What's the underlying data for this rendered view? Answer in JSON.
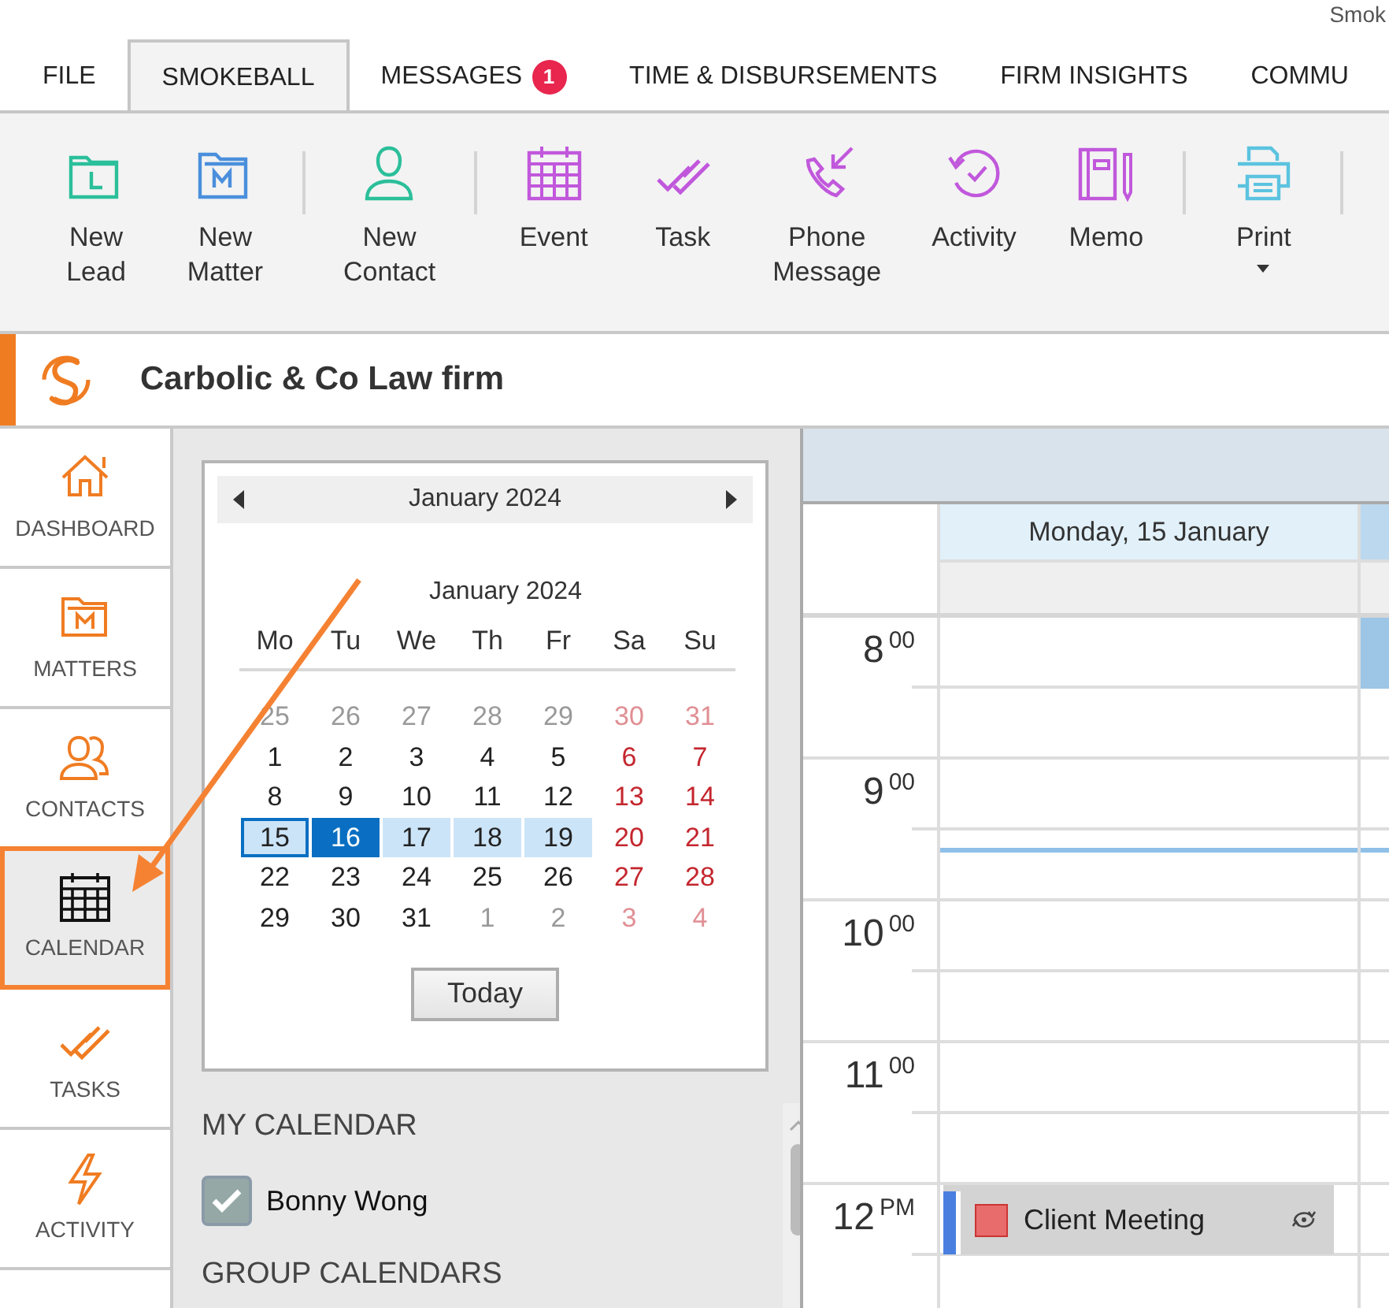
{
  "title_bar": {
    "title": "Smok"
  },
  "tabs": [
    {
      "label": "FILE",
      "selected": false
    },
    {
      "label": "SMOKEBALL",
      "selected": true
    },
    {
      "label": "MESSAGES",
      "selected": false,
      "badge": "1"
    },
    {
      "label": "TIME & DISBURSEMENTS",
      "selected": false
    },
    {
      "label": "FIRM INSIGHTS",
      "selected": false
    },
    {
      "label": "COMMU",
      "selected": false
    }
  ],
  "ribbon": [
    {
      "label": "New Lead",
      "color": "#2bbf9a",
      "separator_after": false
    },
    {
      "label": "New Matter",
      "color": "#4a8fdc",
      "separator_after": true
    },
    {
      "label": "New Contact",
      "color": "#2bbf9a",
      "separator_after": true
    },
    {
      "label": "Event",
      "color": "#c158dc",
      "separator_after": false
    },
    {
      "label": "Task",
      "color": "#c158dc",
      "separator_after": false
    },
    {
      "label": "Phone Message",
      "color": "#c158dc",
      "separator_after": false
    },
    {
      "label": "Activity",
      "color": "#c158dc",
      "separator_after": false
    },
    {
      "label": "Memo",
      "color": "#c158dc",
      "separator_after": true
    },
    {
      "label": "Print",
      "color": "#5bc3e0",
      "separator_after": true,
      "dropdown": true
    }
  ],
  "firm": {
    "name": "Carbolic & Co Law firm"
  },
  "nav": [
    {
      "label": "DASHBOARD",
      "selected": false
    },
    {
      "label": "MATTERS",
      "selected": false
    },
    {
      "label": "CONTACTS",
      "selected": false
    },
    {
      "label": "CALENDAR",
      "selected": true
    },
    {
      "label": "TASKS",
      "selected": false
    },
    {
      "label": "ACTIVITY",
      "selected": false
    }
  ],
  "mini_calendar": {
    "header": "January 2024",
    "month_title": "January 2024",
    "weekdays": [
      "Mo",
      "Tu",
      "We",
      "Th",
      "Fr",
      "Sa",
      "Su"
    ],
    "weeks": [
      [
        {
          "day": "25",
          "outside": true,
          "weekend": false,
          "today": false,
          "selected": false,
          "in_week": false
        },
        {
          "day": "26",
          "outside": true,
          "weekend": false,
          "today": false,
          "selected": false,
          "in_week": false
        },
        {
          "day": "27",
          "outside": true,
          "weekend": false,
          "today": false,
          "selected": false,
          "in_week": false
        },
        {
          "day": "28",
          "outside": true,
          "weekend": false,
          "today": false,
          "selected": false,
          "in_week": false
        },
        {
          "day": "29",
          "outside": true,
          "weekend": false,
          "today": false,
          "selected": false,
          "in_week": false
        },
        {
          "day": "30",
          "outside": true,
          "weekend": true,
          "today": false,
          "selected": false,
          "in_week": false
        },
        {
          "day": "31",
          "outside": true,
          "weekend": true,
          "today": false,
          "selected": false,
          "in_week": false
        }
      ],
      [
        {
          "day": "1",
          "outside": false,
          "weekend": false,
          "today": false,
          "selected": false,
          "in_week": false
        },
        {
          "day": "2",
          "outside": false,
          "weekend": false,
          "today": false,
          "selected": false,
          "in_week": false
        },
        {
          "day": "3",
          "outside": false,
          "weekend": false,
          "today": false,
          "selected": false,
          "in_week": false
        },
        {
          "day": "4",
          "outside": false,
          "weekend": false,
          "today": false,
          "selected": false,
          "in_week": false
        },
        {
          "day": "5",
          "outside": false,
          "weekend": false,
          "today": false,
          "selected": false,
          "in_week": false
        },
        {
          "day": "6",
          "outside": false,
          "weekend": true,
          "today": false,
          "selected": false,
          "in_week": false
        },
        {
          "day": "7",
          "outside": false,
          "weekend": true,
          "today": false,
          "selected": false,
          "in_week": false
        }
      ],
      [
        {
          "day": "8",
          "outside": false,
          "weekend": false,
          "today": false,
          "selected": false,
          "in_week": false
        },
        {
          "day": "9",
          "outside": false,
          "weekend": false,
          "today": false,
          "selected": false,
          "in_week": false
        },
        {
          "day": "10",
          "outside": false,
          "weekend": false,
          "today": false,
          "selected": false,
          "in_week": false
        },
        {
          "day": "11",
          "outside": false,
          "weekend": false,
          "today": false,
          "selected": false,
          "in_week": false
        },
        {
          "day": "12",
          "outside": false,
          "weekend": false,
          "today": false,
          "selected": false,
          "in_week": false
        },
        {
          "day": "13",
          "outside": false,
          "weekend": true,
          "today": false,
          "selected": false,
          "in_week": false
        },
        {
          "day": "14",
          "outside": false,
          "weekend": true,
          "today": false,
          "selected": false,
          "in_week": false
        }
      ],
      [
        {
          "day": "15",
          "outside": false,
          "weekend": false,
          "today": true,
          "selected": false,
          "in_week": true
        },
        {
          "day": "16",
          "outside": false,
          "weekend": false,
          "today": false,
          "selected": true,
          "in_week": true
        },
        {
          "day": "17",
          "outside": false,
          "weekend": false,
          "today": false,
          "selected": false,
          "in_week": true
        },
        {
          "day": "18",
          "outside": false,
          "weekend": false,
          "today": false,
          "selected": false,
          "in_week": true
        },
        {
          "day": "19",
          "outside": false,
          "weekend": false,
          "today": false,
          "selected": false,
          "in_week": true
        },
        {
          "day": "20",
          "outside": false,
          "weekend": true,
          "today": false,
          "selected": false,
          "in_week": false
        },
        {
          "day": "21",
          "outside": false,
          "weekend": true,
          "today": false,
          "selected": false,
          "in_week": false
        }
      ],
      [
        {
          "day": "22",
          "outside": false,
          "weekend": false,
          "today": false,
          "selected": false,
          "in_week": false
        },
        {
          "day": "23",
          "outside": false,
          "weekend": false,
          "today": false,
          "selected": false,
          "in_week": false
        },
        {
          "day": "24",
          "outside": false,
          "weekend": false,
          "today": false,
          "selected": false,
          "in_week": false
        },
        {
          "day": "25",
          "outside": false,
          "weekend": false,
          "today": false,
          "selected": false,
          "in_week": false
        },
        {
          "day": "26",
          "outside": false,
          "weekend": false,
          "today": false,
          "selected": false,
          "in_week": false
        },
        {
          "day": "27",
          "outside": false,
          "weekend": true,
          "today": false,
          "selected": false,
          "in_week": false
        },
        {
          "day": "28",
          "outside": false,
          "weekend": true,
          "today": false,
          "selected": false,
          "in_week": false
        }
      ],
      [
        {
          "day": "29",
          "outside": false,
          "weekend": false,
          "today": false,
          "selected": false,
          "in_week": false
        },
        {
          "day": "30",
          "outside": false,
          "weekend": false,
          "today": false,
          "selected": false,
          "in_week": false
        },
        {
          "day": "31",
          "outside": false,
          "weekend": false,
          "today": false,
          "selected": false,
          "in_week": false
        },
        {
          "day": "1",
          "outside": true,
          "weekend": false,
          "today": false,
          "selected": false,
          "in_week": false
        },
        {
          "day": "2",
          "outside": true,
          "weekend": false,
          "today": false,
          "selected": false,
          "in_week": false
        },
        {
          "day": "3",
          "outside": true,
          "weekend": true,
          "today": false,
          "selected": false,
          "in_week": false
        },
        {
          "day": "4",
          "outside": true,
          "weekend": true,
          "today": false,
          "selected": false,
          "in_week": false
        }
      ]
    ],
    "today_button": "Today"
  },
  "my_calendar": {
    "heading": "MY CALENDAR",
    "items": [
      {
        "name": "Bonny Wong",
        "checked": true
      }
    ]
  },
  "group_calendars": {
    "heading": "GROUP CALENDARS"
  },
  "day_view": {
    "day_header": "Monday, 15 January",
    "hours": [
      {
        "hour": "8",
        "suffix": "00"
      },
      {
        "hour": "9",
        "suffix": "00"
      },
      {
        "hour": "10",
        "suffix": "00"
      },
      {
        "hour": "11",
        "suffix": "00"
      },
      {
        "hour": "12",
        "suffix": "PM",
        "events": [
          {
            "title": "Client Meeting",
            "color": "#e86c6c",
            "recurring": true
          }
        ]
      }
    ]
  }
}
